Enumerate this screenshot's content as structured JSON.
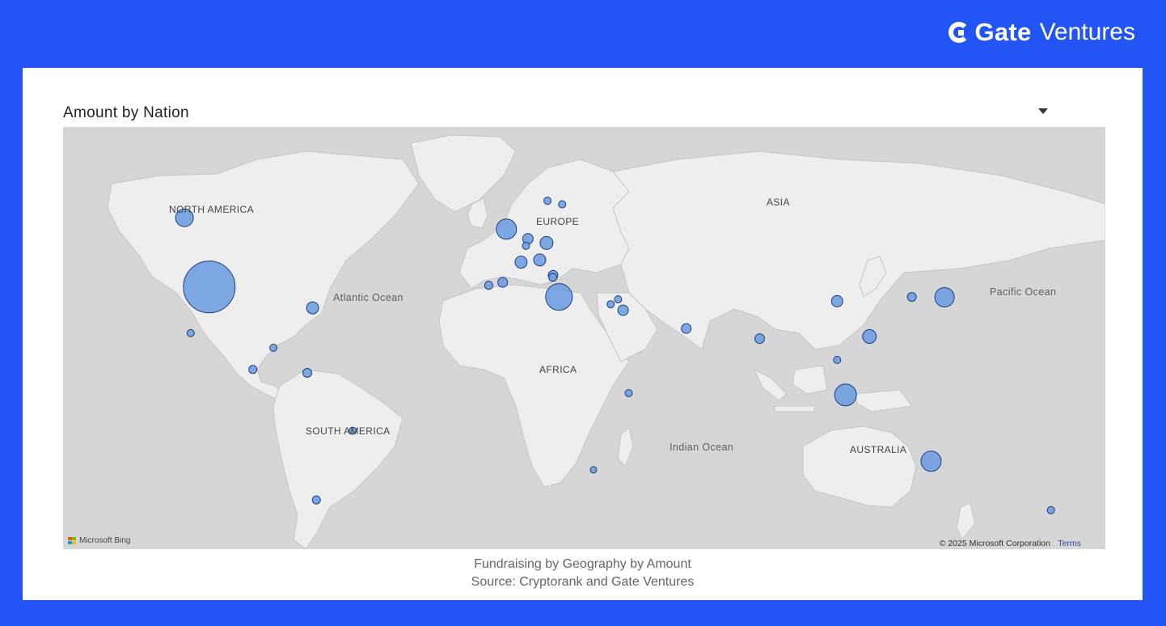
{
  "brand": {
    "name": "Gate",
    "sub": "Ventures"
  },
  "visual": {
    "title": "Amount by Nation",
    "menu_icon": "caret-down-icon"
  },
  "map": {
    "provider_label": "Microsoft Bing",
    "copyright": "© 2025 Microsoft Corporation",
    "terms": "Terms",
    "land_color": "#eeeeee",
    "water_color": "#d6d6d6",
    "bubble_fill": "#6f9ee0",
    "bubble_stroke": "#1c3f7a",
    "labels": {
      "north_america": "NORTH AMERICA",
      "europe": "EUROPE",
      "asia": "ASIA",
      "africa": "AFRICA",
      "south_america": "SOUTH AMERICA",
      "australia": "AUSTRALIA",
      "atlantic": "Atlantic Ocean",
      "pacific": "Pacific Ocean",
      "indian": "Indian Ocean"
    },
    "bubbles": [
      {
        "lon": -98,
        "lat": 39,
        "size": 32
      },
      {
        "lon": -106,
        "lat": 57,
        "size": 11
      },
      {
        "lon": -64.8,
        "lat": 32.3,
        "size": 7.5
      },
      {
        "lon": -104,
        "lat": 23.5,
        "size": 4.5
      },
      {
        "lon": -84,
        "lat": 9.8,
        "size": 5
      },
      {
        "lon": -77.4,
        "lat": 18.1,
        "size": 4.5
      },
      {
        "lon": -66.5,
        "lat": 8.5,
        "size": 5.5
      },
      {
        "lon": -51.9,
        "lat": -14.2,
        "size": 4.5
      },
      {
        "lon": -63.6,
        "lat": -38.4,
        "size": 5
      },
      {
        "lon": -2.5,
        "lat": 54.5,
        "size": 12.5
      },
      {
        "lon": 10.7,
        "lat": 60.5,
        "size": 4.5
      },
      {
        "lon": 15.4,
        "lat": 59.8,
        "size": 4.5
      },
      {
        "lon": 4.4,
        "lat": 52.2,
        "size": 6.5
      },
      {
        "lon": 3.8,
        "lat": 50.5,
        "size": 4.5
      },
      {
        "lon": 10.4,
        "lat": 51.2,
        "size": 8
      },
      {
        "lon": 2.2,
        "lat": 46.2,
        "size": 7.5
      },
      {
        "lon": 8.2,
        "lat": 46.8,
        "size": 7.5
      },
      {
        "lon": 12.5,
        "lat": 42.5,
        "size": 6
      },
      {
        "lon": 12.4,
        "lat": 41.9,
        "size": 5
      },
      {
        "lon": -8.2,
        "lat": 39.5,
        "size": 5
      },
      {
        "lon": -3.7,
        "lat": 40.4,
        "size": 6
      },
      {
        "lon": 14.4,
        "lat": 35.9,
        "size": 16.5
      },
      {
        "lon": 33.4,
        "lat": 35.1,
        "size": 4.5
      },
      {
        "lon": 31,
        "lat": 33.5,
        "size": 4.5
      },
      {
        "lon": 35,
        "lat": 31.5,
        "size": 6.5
      },
      {
        "lon": 55.3,
        "lat": 25.2,
        "size": 6
      },
      {
        "lon": 36.8,
        "lat": 0.5,
        "size": 4.5
      },
      {
        "lon": 25.5,
        "lat": -28.5,
        "size": 4
      },
      {
        "lon": 78.9,
        "lat": 21.5,
        "size": 6
      },
      {
        "lon": 103.8,
        "lat": 34.5,
        "size": 7
      },
      {
        "lon": 114.2,
        "lat": 22.3,
        "size": 8.5
      },
      {
        "lon": 103.8,
        "lat": 13.5,
        "size": 4.5
      },
      {
        "lon": 106.5,
        "lat": -0.2,
        "size": 13.5
      },
      {
        "lon": 127.8,
        "lat": 35.9,
        "size": 5.5
      },
      {
        "lon": 138.3,
        "lat": 35.8,
        "size": 12
      },
      {
        "lon": 134,
        "lat": -25.5,
        "size": 12.5
      },
      {
        "lon": 172.5,
        "lat": -41.5,
        "size": 4.5
      }
    ]
  },
  "caption": {
    "line1": "Fundraising by Geography by Amount",
    "line2": "Source: Cryptorank and Gate Ventures"
  }
}
